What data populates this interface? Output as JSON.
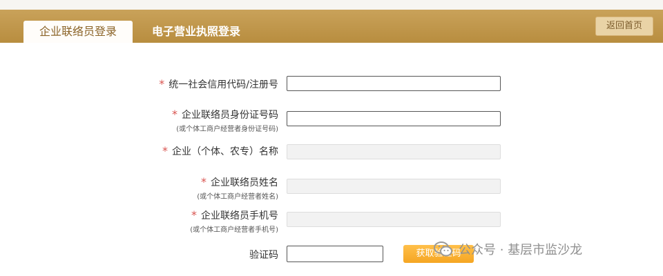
{
  "header": {
    "tabs": [
      {
        "label": "企业联络员登录",
        "active": true
      },
      {
        "label": "电子营业执照登录",
        "active": false
      }
    ],
    "back_button": "返回首页"
  },
  "form": {
    "required_mark": "*",
    "fields": [
      {
        "label": "统一社会信用代码/注册号",
        "sub": "",
        "value": "",
        "disabled": false
      },
      {
        "label": "企业联络员身份证号码",
        "sub": "(或个体工商户经营者身份证号码)",
        "value": "",
        "disabled": false
      },
      {
        "label": "企业（个体、农专）名称",
        "sub": "",
        "value": "",
        "disabled": true
      },
      {
        "label": "企业联络员姓名",
        "sub": "(或个体工商户经营者姓名)",
        "value": "",
        "disabled": true
      },
      {
        "label": "企业联络员手机号",
        "sub": "(或个体工商户经营者手机号)",
        "value": "",
        "disabled": true
      }
    ],
    "captcha_label": "验证码",
    "captcha_button": "获取验证码"
  },
  "watermark": {
    "icon": "wechat-icon",
    "text": "公众号 · 基层市监沙龙"
  },
  "colors": {
    "header": "#b88d3f",
    "required": "#d9534f",
    "captcha_button": "#f5a623"
  }
}
